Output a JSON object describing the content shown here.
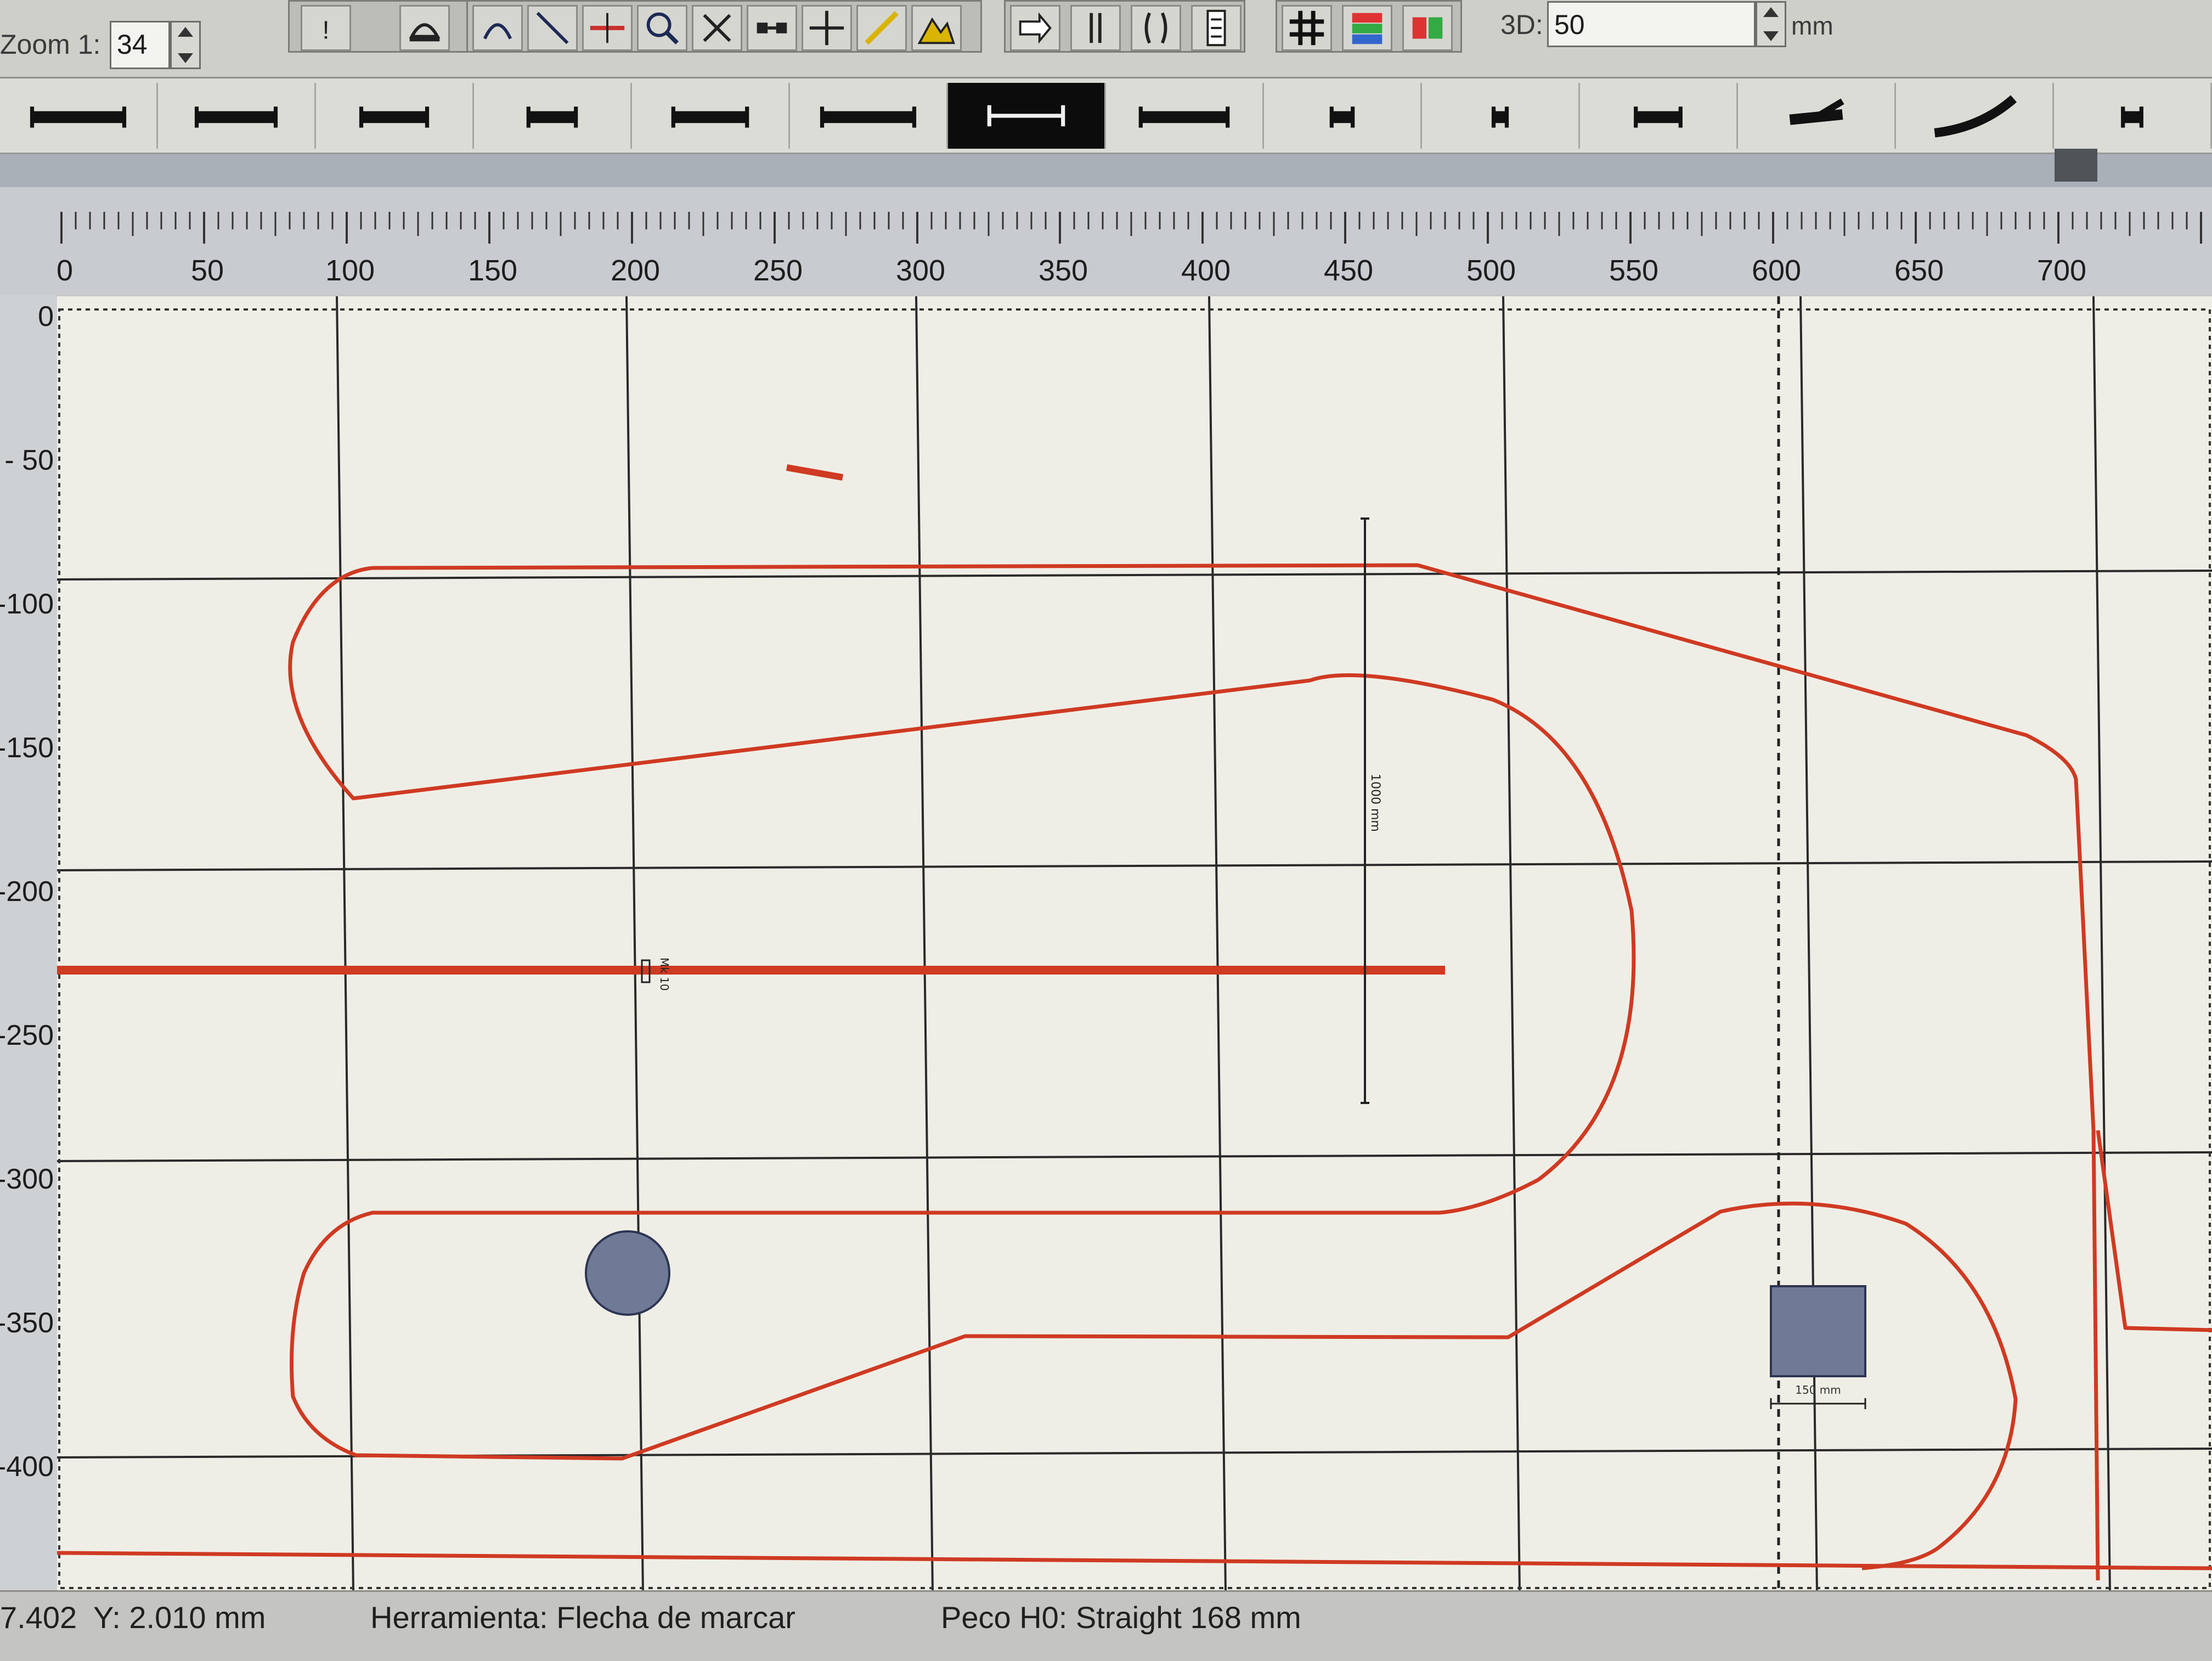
{
  "toolbar": {
    "zoom_label": "Zoom 1:",
    "zoom_value": "34",
    "view_3d_label": "3D:",
    "view_3d_value": "50",
    "unit_label": "mm",
    "mode_buttons": [
      {
        "name": "info-icon",
        "glyph": "!"
      },
      {
        "name": "dome-icon"
      }
    ],
    "draw_buttons": [
      {
        "name": "arc-tool-icon"
      },
      {
        "name": "line-tool-icon"
      },
      {
        "name": "cut-rail-icon"
      },
      {
        "name": "magnifier-icon"
      },
      {
        "name": "scissors-icon"
      },
      {
        "name": "connect-icon"
      },
      {
        "name": "move-arrows-icon"
      },
      {
        "name": "measure-icon"
      },
      {
        "name": "terrain-icon"
      }
    ],
    "track_buttons": [
      {
        "name": "arrow-right-icon"
      },
      {
        "name": "flip-vertical-icon"
      },
      {
        "name": "flip-curve-icon"
      },
      {
        "name": "list-icon"
      }
    ],
    "view_buttons": [
      {
        "name": "grid-icon"
      },
      {
        "name": "layers-3d-icon"
      },
      {
        "name": "color-toggle-icon"
      }
    ]
  },
  "palette": {
    "items": [
      {
        "name": "track-straight-long-icon"
      },
      {
        "name": "track-straight-double-icon"
      },
      {
        "name": "track-straight-medium-icon"
      },
      {
        "name": "track-buffer-icon"
      },
      {
        "name": "track-straight-heavy-icon"
      },
      {
        "name": "track-wagon-icon"
      },
      {
        "name": "track-straight-selected-icon",
        "selected": true
      },
      {
        "name": "track-straight-thin-icon"
      },
      {
        "name": "track-short-icon"
      },
      {
        "name": "track-very-short-icon"
      },
      {
        "name": "track-medium-short-icon"
      },
      {
        "name": "track-turnout-icon"
      },
      {
        "name": "track-curve-icon"
      },
      {
        "name": "track-end-icon"
      }
    ]
  },
  "rulers": {
    "top_labels": [
      "0",
      "50",
      "100",
      "150",
      "200",
      "250",
      "300",
      "350",
      "400",
      "450",
      "500",
      "550",
      "600",
      "650",
      "700"
    ],
    "left_labels": [
      "0",
      "- 50",
      "-100",
      "-150",
      "-200",
      "-250",
      "-300",
      "-350",
      "-400"
    ]
  },
  "canvas": {
    "track_color": "#cf3a22",
    "grid_color": "#2a2a2a",
    "object_color": "#6f7a97",
    "dimension_label_vertical": "1000 mm",
    "dimension_label_square": "150 mm",
    "marker_label": "Mk 10"
  },
  "status": {
    "x_value": "7.402",
    "y_value": "Y: 2.010 mm",
    "tool": "Herramienta: Flecha de marcar",
    "piece": "Peco H0: Straight 168 mm"
  }
}
